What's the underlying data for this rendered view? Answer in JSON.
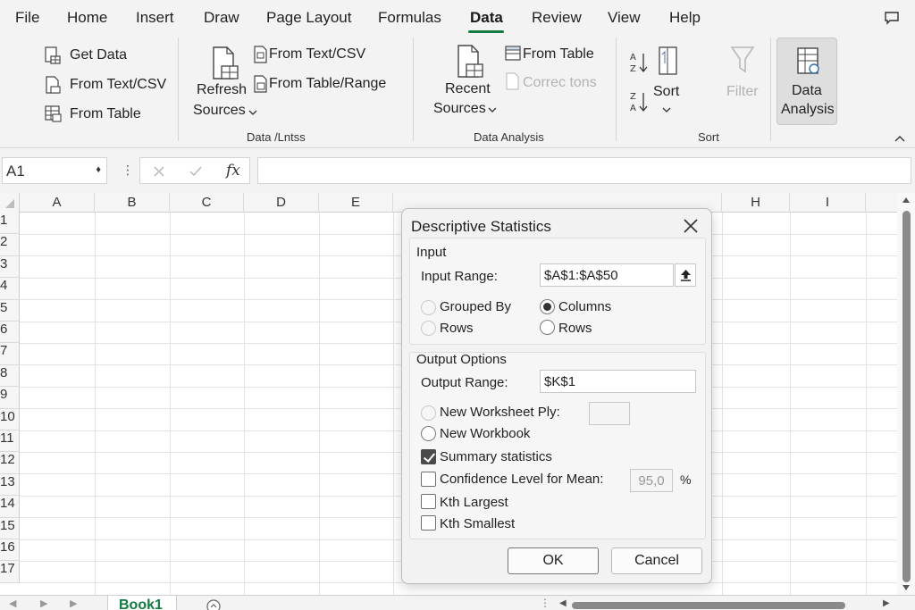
{
  "menu": {
    "items": [
      "File",
      "Home",
      "Insert",
      "Draw",
      "Page Layout",
      "Formulas",
      "Data",
      "Review",
      "View",
      "Help"
    ],
    "active": "Data"
  },
  "ribbon": {
    "get_data": "Get Data",
    "from_text_csv_small": "From Text/CSV",
    "from_table_small": "From Table",
    "refresh": "Refresh",
    "sources": "Sources",
    "from_text_csv": "From Text/CSV",
    "from_table_range": "From Table/Range",
    "group1_label": "Data /Lntss",
    "recent": "Recent",
    "recent_sources": "Sources",
    "from_table": "From Table",
    "connections": "Correc tons",
    "group2_label": "Data Analysis",
    "sort": "Sort",
    "filter": "Filter",
    "group3_label": "Sort",
    "data_analysis_line1": "Data",
    "data_analysis_line2": "Analysis"
  },
  "formula_bar": {
    "name_box": "A1",
    "fx": "fx",
    "value": ""
  },
  "grid": {
    "columns": [
      "A",
      "B",
      "C",
      "D",
      "E",
      "H",
      "I"
    ],
    "rows": [
      "1",
      "2",
      "3",
      "4",
      "5",
      "6",
      "7",
      "8",
      "9",
      "10",
      "11",
      "12",
      "13",
      "14",
      "15",
      "16",
      "17"
    ]
  },
  "sheet_tabs": {
    "active": "Book1"
  },
  "dialog": {
    "title": "Descriptive Statistics",
    "input_section": "Input",
    "input_range_label": "Input Range:",
    "input_range_value": "$A$1:$A$50",
    "grouped_by_label": "Grouped By",
    "grouped_rows_label": "Rows",
    "columns_label": "Columns",
    "rows_label": "Rows",
    "output_section": "Output Options",
    "output_range_label": "Output Range:",
    "output_range_value": "$K$1",
    "new_worksheet_label": "New Worksheet Ply:",
    "new_worksheet_value": "",
    "new_workbook_label": "New Workbook",
    "summary_label": "Summary statistics",
    "confidence_label": "Confidence Level for Mean:",
    "confidence_value": "95,0",
    "percent": "%",
    "kth_largest_label": "Kth Largest",
    "kth_smallest_label": "Kth Smallest",
    "ok": "OK",
    "cancel": "Cancel"
  }
}
